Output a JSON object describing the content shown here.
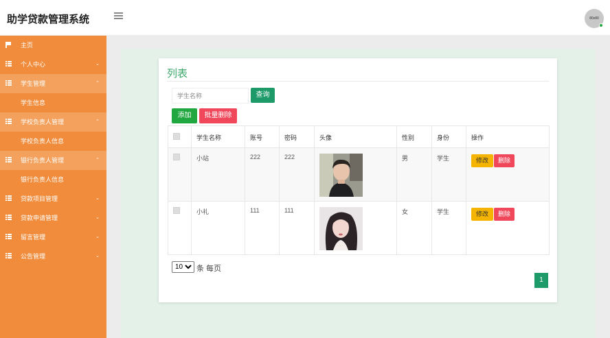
{
  "header": {
    "app_title": "助学贷款管理系统",
    "avatar_text": "80x80"
  },
  "sidebar": {
    "items": [
      {
        "label": "主页",
        "icon": "flag-icon"
      },
      {
        "label": "个人中心",
        "icon": "grid-icon",
        "caret": "⌄"
      },
      {
        "label": "学生管理",
        "icon": "grid-icon",
        "caret": "⌃"
      },
      {
        "label": "学生信息"
      },
      {
        "label": "学校负责人管理",
        "icon": "grid-icon",
        "caret": "⌃"
      },
      {
        "label": "学校负责人信息"
      },
      {
        "label": "银行负责人管理",
        "icon": "grid-icon",
        "caret": "⌃"
      },
      {
        "label": "银行负责人信息"
      },
      {
        "label": "贷款项目管理",
        "icon": "grid-icon",
        "caret": "⌄"
      },
      {
        "label": "贷款申请管理",
        "icon": "grid-icon",
        "caret": "⌄"
      },
      {
        "label": "留言管理",
        "icon": "grid-icon",
        "caret": "⌄"
      },
      {
        "label": "公告管理",
        "icon": "grid-icon",
        "caret": "⌄"
      }
    ]
  },
  "main": {
    "card_title": "列表",
    "search": {
      "placeholder": "学生名称",
      "value": ""
    },
    "buttons": {
      "search": "查询",
      "add": "添加",
      "bulk_delete": "批量删除"
    },
    "table": {
      "columns": [
        "学生名称",
        "账号",
        "密码",
        "头像",
        "性别",
        "身份",
        "操作"
      ],
      "rows": [
        {
          "name": "小站",
          "account": "222",
          "password": "222",
          "gender": "男",
          "role": "学生"
        },
        {
          "name": "小礼",
          "account": "111",
          "password": "111",
          "gender": "女",
          "role": "学生"
        }
      ],
      "actions": {
        "edit": "修改",
        "delete": "删除"
      }
    },
    "pagination": {
      "page_size": "10",
      "page_size_label": "条 每页",
      "current_page": "1"
    }
  },
  "colors": {
    "sidebar": "#f08c3b",
    "primary_green": "#1d9a67",
    "add_green": "#21a73f",
    "danger": "#f0475b",
    "warning": "#f4b400",
    "title_green": "#3ea96b"
  }
}
